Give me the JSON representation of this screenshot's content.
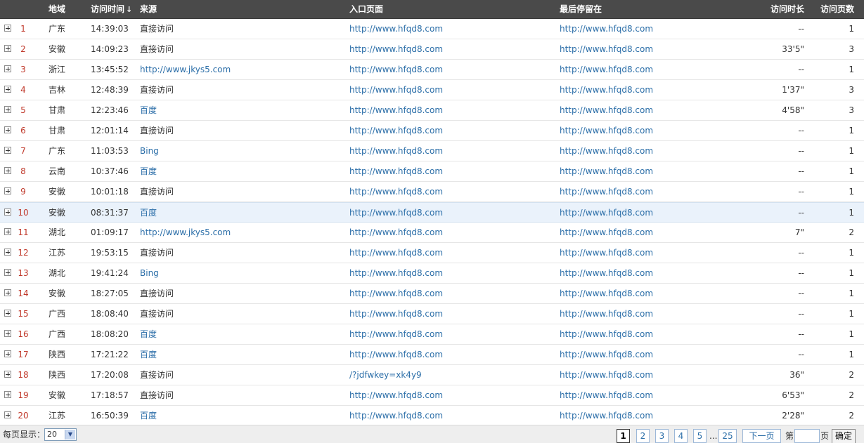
{
  "header": {
    "region": "地域",
    "time": "访问时间",
    "sort_icon": "↓",
    "source": "来源",
    "entry": "入口页面",
    "last": "最后停留在",
    "duration": "访问时长",
    "pages": "访问页数"
  },
  "rows": [
    {
      "num": "1",
      "region": "广东",
      "time": "14:39:03",
      "source": "直接访问",
      "entry": "http://www.hfqd8.com",
      "last": "http://www.hfqd8.com",
      "duration": "--",
      "pages": "1"
    },
    {
      "num": "2",
      "region": "安徽",
      "time": "14:09:23",
      "source": "直接访问",
      "entry": "http://www.hfqd8.com",
      "last": "http://www.hfqd8.com",
      "duration": "33'5\"",
      "pages": "3"
    },
    {
      "num": "3",
      "region": "浙江",
      "time": "13:45:52",
      "source": "http://www.jkys5.com",
      "entry": "http://www.hfqd8.com",
      "last": "http://www.hfqd8.com",
      "duration": "--",
      "pages": "1"
    },
    {
      "num": "4",
      "region": "吉林",
      "time": "12:48:39",
      "source": "直接访问",
      "entry": "http://www.hfqd8.com",
      "last": "http://www.hfqd8.com",
      "duration": "1'37\"",
      "pages": "3"
    },
    {
      "num": "5",
      "region": "甘肃",
      "time": "12:23:46",
      "source": "百度",
      "entry": "http://www.hfqd8.com",
      "last": "http://www.hfqd8.com",
      "duration": "4'58\"",
      "pages": "3"
    },
    {
      "num": "6",
      "region": "甘肃",
      "time": "12:01:14",
      "source": "直接访问",
      "entry": "http://www.hfqd8.com",
      "last": "http://www.hfqd8.com",
      "duration": "--",
      "pages": "1"
    },
    {
      "num": "7",
      "region": "广东",
      "time": "11:03:53",
      "source": "Bing",
      "entry": "http://www.hfqd8.com",
      "last": "http://www.hfqd8.com",
      "duration": "--",
      "pages": "1"
    },
    {
      "num": "8",
      "region": "云南",
      "time": "10:37:46",
      "source": "百度",
      "entry": "http://www.hfqd8.com",
      "last": "http://www.hfqd8.com",
      "duration": "--",
      "pages": "1"
    },
    {
      "num": "9",
      "region": "安徽",
      "time": "10:01:18",
      "source": "直接访问",
      "entry": "http://www.hfqd8.com",
      "last": "http://www.hfqd8.com",
      "duration": "--",
      "pages": "1"
    },
    {
      "num": "10",
      "region": "安徽",
      "time": "08:31:37",
      "source": "百度",
      "entry": "http://www.hfqd8.com",
      "last": "http://www.hfqd8.com",
      "duration": "--",
      "pages": "1"
    },
    {
      "num": "11",
      "region": "湖北",
      "time": "01:09:17",
      "source": "http://www.jkys5.com",
      "entry": "http://www.hfqd8.com",
      "last": "http://www.hfqd8.com",
      "duration": "7\"",
      "pages": "2"
    },
    {
      "num": "12",
      "region": "江苏",
      "time": "19:53:15",
      "source": "直接访问",
      "entry": "http://www.hfqd8.com",
      "last": "http://www.hfqd8.com",
      "duration": "--",
      "pages": "1"
    },
    {
      "num": "13",
      "region": "湖北",
      "time": "19:41:24",
      "source": "Bing",
      "entry": "http://www.hfqd8.com",
      "last": "http://www.hfqd8.com",
      "duration": "--",
      "pages": "1"
    },
    {
      "num": "14",
      "region": "安徽",
      "time": "18:27:05",
      "source": "直接访问",
      "entry": "http://www.hfqd8.com",
      "last": "http://www.hfqd8.com",
      "duration": "--",
      "pages": "1"
    },
    {
      "num": "15",
      "region": "广西",
      "time": "18:08:40",
      "source": "直接访问",
      "entry": "http://www.hfqd8.com",
      "last": "http://www.hfqd8.com",
      "duration": "--",
      "pages": "1"
    },
    {
      "num": "16",
      "region": "广西",
      "time": "18:08:20",
      "source": "百度",
      "entry": "http://www.hfqd8.com",
      "last": "http://www.hfqd8.com",
      "duration": "--",
      "pages": "1"
    },
    {
      "num": "17",
      "region": "陕西",
      "time": "17:21:22",
      "source": "百度",
      "entry": "http://www.hfqd8.com",
      "last": "http://www.hfqd8.com",
      "duration": "--",
      "pages": "1"
    },
    {
      "num": "18",
      "region": "陕西",
      "time": "17:20:08",
      "source": "直接访问",
      "entry": "/?jdfwkey=xk4y9",
      "last": "http://www.hfqd8.com",
      "duration": "36\"",
      "pages": "2"
    },
    {
      "num": "19",
      "region": "安徽",
      "time": "17:18:57",
      "source": "直接访问",
      "entry": "http://www.hfqd8.com",
      "last": "http://www.hfqd8.com",
      "duration": "6'53\"",
      "pages": "2"
    },
    {
      "num": "20",
      "region": "江苏",
      "time": "16:50:39",
      "source": "百度",
      "entry": "http://www.hfqd8.com",
      "last": "http://www.hfqd8.com",
      "duration": "2'28\"",
      "pages": "2"
    }
  ],
  "footer": {
    "per_page_label": "每页显示：",
    "per_page_value": "20",
    "pages": [
      "1",
      "2",
      "3",
      "4",
      "5"
    ],
    "current_page": "1",
    "ellipsis": "...",
    "last_page": "25",
    "next_label": "下一页>",
    "goto_prefix": "第",
    "goto_suffix": "页",
    "confirm_label": "确定"
  },
  "colors": {
    "header_bg": "#4a4a4a",
    "link": "#2b6ea8",
    "row_number": "#c0392b",
    "highlight_row": "#eaf2fb"
  },
  "icons": {
    "expand": "expand-plus-icon",
    "sort": "sort-down-arrow-icon",
    "dropdown": "chevron-down-icon"
  },
  "highlight_row_index": 9
}
